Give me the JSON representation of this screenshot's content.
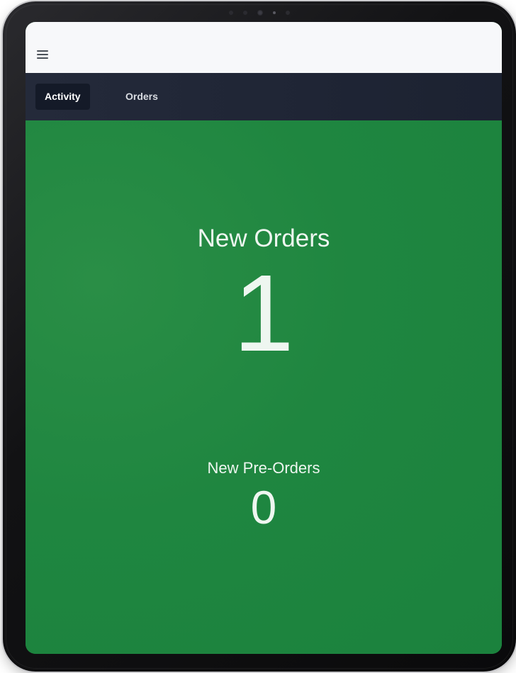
{
  "navigation": {
    "menu_icon": "hamburger-menu-icon",
    "tabs": [
      {
        "label": "Activity",
        "active": true
      },
      {
        "label": "Orders",
        "active": false
      }
    ]
  },
  "dashboard": {
    "background_color": "#1c843e",
    "new_orders": {
      "label": "New Orders",
      "value": "1"
    },
    "new_pre_orders": {
      "label": "New Pre-Orders",
      "value": "0"
    }
  }
}
